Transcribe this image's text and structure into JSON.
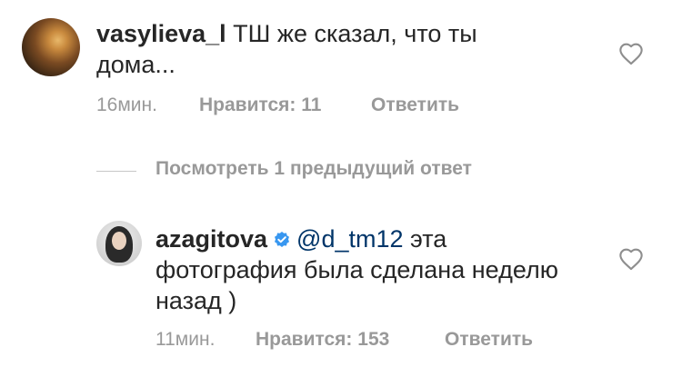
{
  "comments": [
    {
      "username": "vasylieva_l",
      "text_line1": "ТШ же сказал, что ты",
      "text_line2": "дома...",
      "time": "16мин.",
      "likes": "Нравится: 11",
      "reply": "Ответить"
    },
    {
      "username": "azagitova",
      "verified": true,
      "mention": "@d_tm12",
      "text_line1_rest": " эта",
      "text_line2": "фотография была сделана неделю",
      "text_line3": "назад )",
      "time": "11мин.",
      "likes": "Нравится: 153",
      "reply": "Ответить"
    }
  ],
  "thread": {
    "view_previous_label": "Посмотреть 1 предыдущий ответ"
  },
  "colors": {
    "text": "#262626",
    "secondary": "#999999",
    "mention": "#003569",
    "verified": "#3897f0"
  },
  "icons": {
    "like": "heart-outline-icon",
    "verified": "verified-badge-icon"
  }
}
